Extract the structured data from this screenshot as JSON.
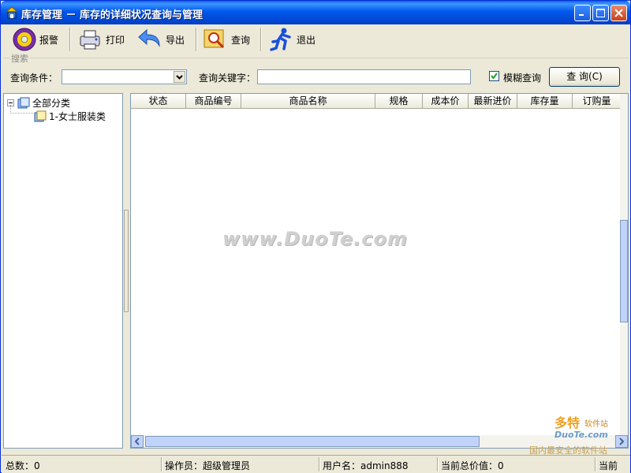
{
  "window": {
    "title": "库存管理 － 库存的详细状况查询与管理"
  },
  "toolbar": {
    "alarm_label": "报警",
    "print_label": "打印",
    "export_label": "导出",
    "query_label": "查询",
    "exit_label": "退出"
  },
  "search": {
    "legend": "搜索",
    "condition_label": "查询条件：",
    "condition_value": "",
    "keyword_label": "查询关键字：",
    "keyword_value": "",
    "fuzzy_label": "模糊查询",
    "fuzzy_checked": true,
    "query_button": "查 询(C)"
  },
  "tree": {
    "root_label": "全部分类",
    "children": [
      {
        "label": "1-女士服装类"
      }
    ]
  },
  "grid": {
    "columns": [
      "状态",
      "商品编号",
      "商品名称",
      "规格",
      "成本价",
      "最新进价",
      "库存量",
      "订购量"
    ],
    "rows": []
  },
  "watermark": "www.DuoTe.com",
  "corner_logo": {
    "brand": "多特",
    "suffix": "软件站",
    "site": "DuoTe.com",
    "slogan": "国内最安全的软件站"
  },
  "status": {
    "total": "总数：0",
    "operator": "操作员：超级管理员",
    "username": "用户名：admin888",
    "total_value": "当前总价值：0",
    "current": "当前"
  },
  "colors": {
    "title_bar": "#0058ee",
    "window_bg": "#ece9d8",
    "border": "#7f9db9"
  }
}
